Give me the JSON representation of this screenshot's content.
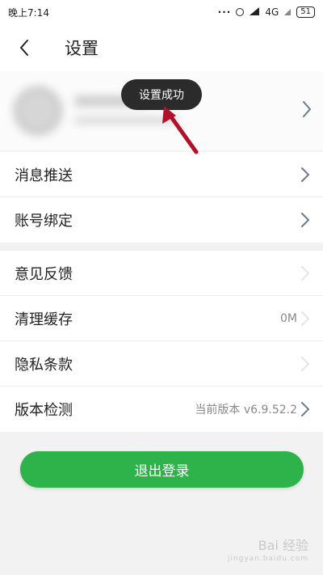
{
  "status_bar": {
    "time": "晚上7:14",
    "network": "4G",
    "battery": "51"
  },
  "header": {
    "title": "设置"
  },
  "toast": {
    "message": "设置成功"
  },
  "group1": [
    {
      "label": "消息推送"
    },
    {
      "label": "账号绑定"
    }
  ],
  "group2": [
    {
      "label": "意见反馈",
      "value": ""
    },
    {
      "label": "清理缓存",
      "value": "0M"
    },
    {
      "label": "隐私条款",
      "value": ""
    },
    {
      "label": "版本检测",
      "value": "当前版本 v6.9.52.2"
    }
  ],
  "logout": {
    "label": "退出登录"
  },
  "watermark": {
    "text": "Bai 经验",
    "subtext": "jingyan.baidu.com"
  },
  "colors": {
    "accent": "#2db34a",
    "toast_bg": "#2b2b2b",
    "arrow": "#b0122a"
  }
}
